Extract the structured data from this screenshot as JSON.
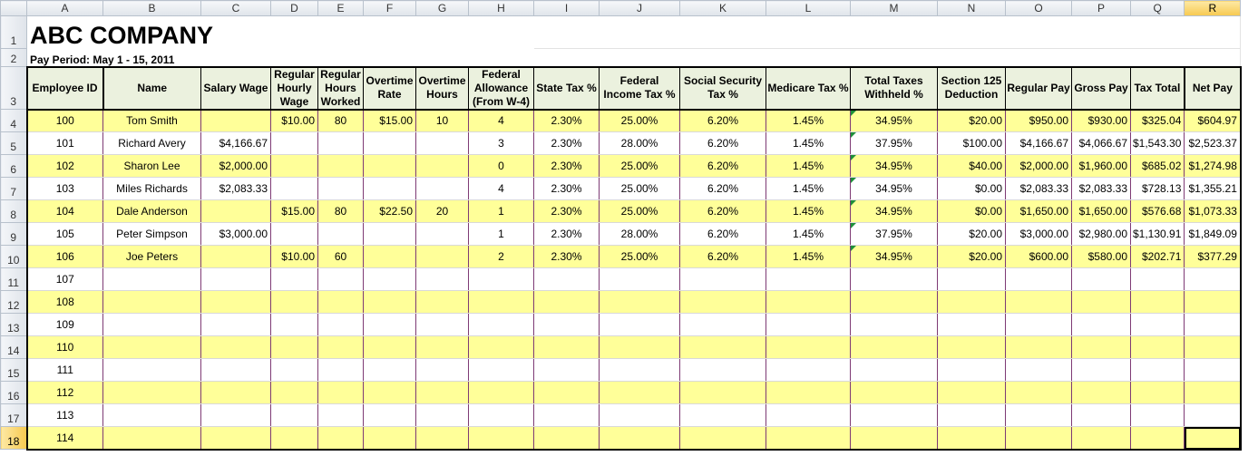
{
  "columns": [
    "A",
    "B",
    "C",
    "D",
    "E",
    "F",
    "G",
    "H",
    "I",
    "J",
    "K",
    "L",
    "M",
    "N",
    "O",
    "P",
    "Q",
    "R"
  ],
  "row_numbers": [
    "1",
    "2",
    "3",
    "4",
    "5",
    "6",
    "7",
    "8",
    "9",
    "10",
    "11",
    "12",
    "13",
    "14",
    "15",
    "16",
    "17",
    "18"
  ],
  "title": "ABC COMPANY",
  "pay_period": "Pay Period:   May 1 - 15, 2011",
  "headers": [
    "Employee ID",
    "Name",
    "Salary Wage",
    "Regular Hourly Wage",
    "Regular Hours Worked",
    "Overtime Rate",
    "Overtime Hours",
    "Federal Allowance (From W-4)",
    "State Tax %",
    "Federal Income Tax %",
    "Social Security Tax %",
    "Medicare Tax %",
    "Total Taxes Withheld %",
    "Section 125 Deduction",
    "Regular Pay",
    "Gross Pay",
    "Tax Total",
    "Net Pay"
  ],
  "rows": [
    [
      "100",
      "Tom Smith",
      "",
      "$10.00",
      "80",
      "$15.00",
      "10",
      "4",
      "2.30%",
      "25.00%",
      "6.20%",
      "1.45%",
      "34.95%",
      "$20.00",
      "$950.00",
      "$930.00",
      "$325.04",
      "$604.97"
    ],
    [
      "101",
      "Richard Avery",
      "$4,166.67",
      "",
      "",
      "",
      "",
      "3",
      "2.30%",
      "28.00%",
      "6.20%",
      "1.45%",
      "37.95%",
      "$100.00",
      "$4,166.67",
      "$4,066.67",
      "$1,543.30",
      "$2,523.37"
    ],
    [
      "102",
      "Sharon Lee",
      "$2,000.00",
      "",
      "",
      "",
      "",
      "0",
      "2.30%",
      "25.00%",
      "6.20%",
      "1.45%",
      "34.95%",
      "$40.00",
      "$2,000.00",
      "$1,960.00",
      "$685.02",
      "$1,274.98"
    ],
    [
      "103",
      "Miles Richards",
      "$2,083.33",
      "",
      "",
      "",
      "",
      "4",
      "2.30%",
      "25.00%",
      "6.20%",
      "1.45%",
      "34.95%",
      "$0.00",
      "$2,083.33",
      "$2,083.33",
      "$728.13",
      "$1,355.21"
    ],
    [
      "104",
      "Dale Anderson",
      "",
      "$15.00",
      "80",
      "$22.50",
      "20",
      "1",
      "2.30%",
      "25.00%",
      "6.20%",
      "1.45%",
      "34.95%",
      "$0.00",
      "$1,650.00",
      "$1,650.00",
      "$576.68",
      "$1,073.33"
    ],
    [
      "105",
      "Peter Simpson",
      "$3,000.00",
      "",
      "",
      "",
      "",
      "1",
      "2.30%",
      "28.00%",
      "6.20%",
      "1.45%",
      "37.95%",
      "$20.00",
      "$3,000.00",
      "$2,980.00",
      "$1,130.91",
      "$1,849.09"
    ],
    [
      "106",
      "Joe Peters",
      "",
      "$10.00",
      "60",
      "",
      "",
      "2",
      "2.30%",
      "25.00%",
      "6.20%",
      "1.45%",
      "34.95%",
      "$20.00",
      "$600.00",
      "$580.00",
      "$202.71",
      "$377.29"
    ],
    [
      "107",
      "",
      "",
      "",
      "",
      "",
      "",
      "",
      "",
      "",
      "",
      "",
      "",
      "",
      "",
      "",
      "",
      ""
    ],
    [
      "108",
      "",
      "",
      "",
      "",
      "",
      "",
      "",
      "",
      "",
      "",
      "",
      "",
      "",
      "",
      "",
      "",
      ""
    ],
    [
      "109",
      "",
      "",
      "",
      "",
      "",
      "",
      "",
      "",
      "",
      "",
      "",
      "",
      "",
      "",
      "",
      "",
      ""
    ],
    [
      "110",
      "",
      "",
      "",
      "",
      "",
      "",
      "",
      "",
      "",
      "",
      "",
      "",
      "",
      "",
      "",
      "",
      ""
    ],
    [
      "111",
      "",
      "",
      "",
      "",
      "",
      "",
      "",
      "",
      "",
      "",
      "",
      "",
      "",
      "",
      "",
      "",
      ""
    ],
    [
      "112",
      "",
      "",
      "",
      "",
      "",
      "",
      "",
      "",
      "",
      "",
      "",
      "",
      "",
      "",
      "",
      "",
      ""
    ],
    [
      "113",
      "",
      "",
      "",
      "",
      "",
      "",
      "",
      "",
      "",
      "",
      "",
      "",
      "",
      "",
      "",
      "",
      ""
    ],
    [
      "114",
      "",
      "",
      "",
      "",
      "",
      "",
      "",
      "",
      "",
      "",
      "",
      "",
      "",
      "",
      "",
      "",
      ""
    ]
  ],
  "selected_column": "R",
  "selected_row": "18",
  "colors": {
    "band_yellow": "#ffff99",
    "header_green": "#ebf1de",
    "column_border": "#7e3a75"
  }
}
